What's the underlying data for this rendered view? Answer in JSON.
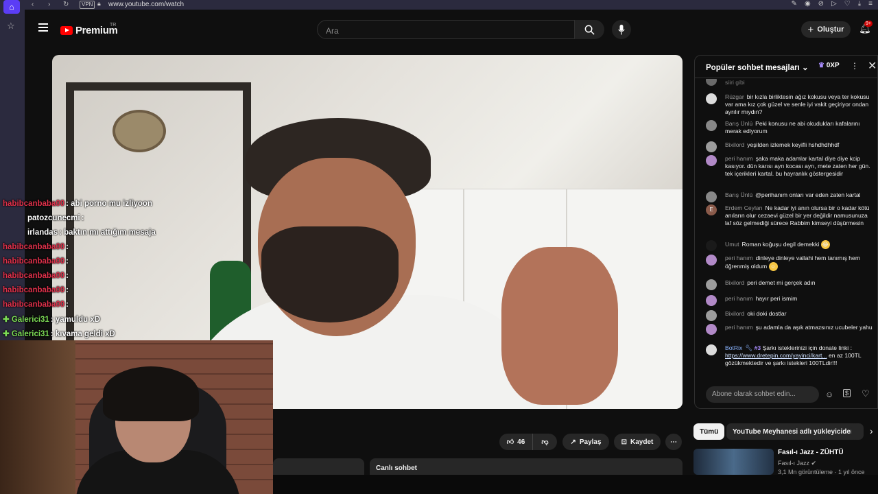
{
  "browser": {
    "url": "www.youtube.com/watch",
    "vpn_label": "VPN"
  },
  "header": {
    "logo": "Premium",
    "region": "TR",
    "search_placeholder": "Ara",
    "create_label": "Oluştur",
    "notif_badge": "9+"
  },
  "overlay_chat": [
    {
      "user": "habibcanbaba00",
      "msg": "abi porno mu izliyoon",
      "color": "#e0314b"
    },
    {
      "user": "patozcunecmi",
      "msg": "",
      "color": "#ffffff"
    },
    {
      "user": "irlandas",
      "msg": "baktın mı attığım mesaja",
      "color": "#ffffff"
    },
    {
      "user": "habibcanbaba00",
      "msg": "",
      "color": "#e0314b"
    },
    {
      "user": "habibcanbaba00",
      "msg": "",
      "color": "#e0314b"
    },
    {
      "user": "habibcanbaba00",
      "msg": "",
      "color": "#e0314b"
    },
    {
      "user": "habibcanbaba00",
      "msg": "",
      "color": "#e0314b"
    },
    {
      "user": "habibcanbaba00",
      "msg": "",
      "color": "#e0314b"
    },
    {
      "user": "Galerici31",
      "msg": "yamuldu xD",
      "color": "#7cdb55"
    },
    {
      "user": "Galerici31",
      "msg": "kıvama geldi xD",
      "color": "#7cdb55"
    }
  ],
  "actions": {
    "likes": "46",
    "share": "Paylaş",
    "save": "Kaydet"
  },
  "live_chat_tab": "Canlı sohbet",
  "chat": {
    "title": "Popüler sohbet mesajları",
    "xp": "0XP",
    "input_placeholder": "Abone olarak sohbet edin...",
    "messages": [
      {
        "name": "Rüzgar",
        "text": "bir kızla birliktesin ağız kokusu veya ter kokusu var ama kız çok güzel ve senle iyi vakit geçiriyor ondan ayrılır mıydın?"
      },
      {
        "name": "Barış Ünlü",
        "text": "Peki konusu ne abi okudukları kafalarını merak ediyorum"
      },
      {
        "name": "Bixilord",
        "text": "yeşilden izlemek keyifli hshdhdhhdf"
      },
      {
        "name": "peri hanım",
        "text": "şaka maka adamlar kartal diye diye kcip kasıyor. dün karısı ayrı kocası ayrı, mete zaten her gün. tek içerikleri kartal. bu hayranlık göstergesidir"
      },
      {
        "name": "Barış Ünlü",
        "text": "@perihanım onları var eden zaten kartal"
      },
      {
        "name": "Erdem Ceylan",
        "text": "Ne kadar iyi anın olursa bir o kadar kötü anıların olur cezaevi güzel bir yer değildir namusunuza laf söz gelmediği sürece Rabbim kimseyi düşürmesin"
      },
      {
        "name": "Umut",
        "text": "Roman koğuşu degil demekki"
      },
      {
        "name": "peri hanım",
        "text": "dinleye dinleye vallahi hem tanımış hem öğrenmiş oldum"
      },
      {
        "name": "Bixilord",
        "text": "peri demet mi gerçek adın"
      },
      {
        "name": "peri hanım",
        "text": "hayır peri ismim"
      },
      {
        "name": "Bixilord",
        "text": "oki doki dostlar"
      },
      {
        "name": "peri hanım",
        "text": "şu adamla da aşık atmazsınız ucubeler yahu"
      },
      {
        "name": "BotRix",
        "badge": "#3",
        "text": "Şarkı isteklerinizi için donate linki :",
        "link": "https://www.dretepin.com/yayinci/kart...",
        "text2": "en az 100TL gözükmektedir ve şarkı istekleri 100TLdir!!!"
      }
    ]
  },
  "chips": [
    "Tümü",
    "YouTube Meyhanesi adlı yükleyiciden"
  ],
  "recommendation": {
    "title": "Fasıl-ı Jazz - ZÜHTÜ",
    "channel": "Fasıl-ı Jazz",
    "meta": "3,1 Mn görüntüleme · 1 yıl önce"
  }
}
